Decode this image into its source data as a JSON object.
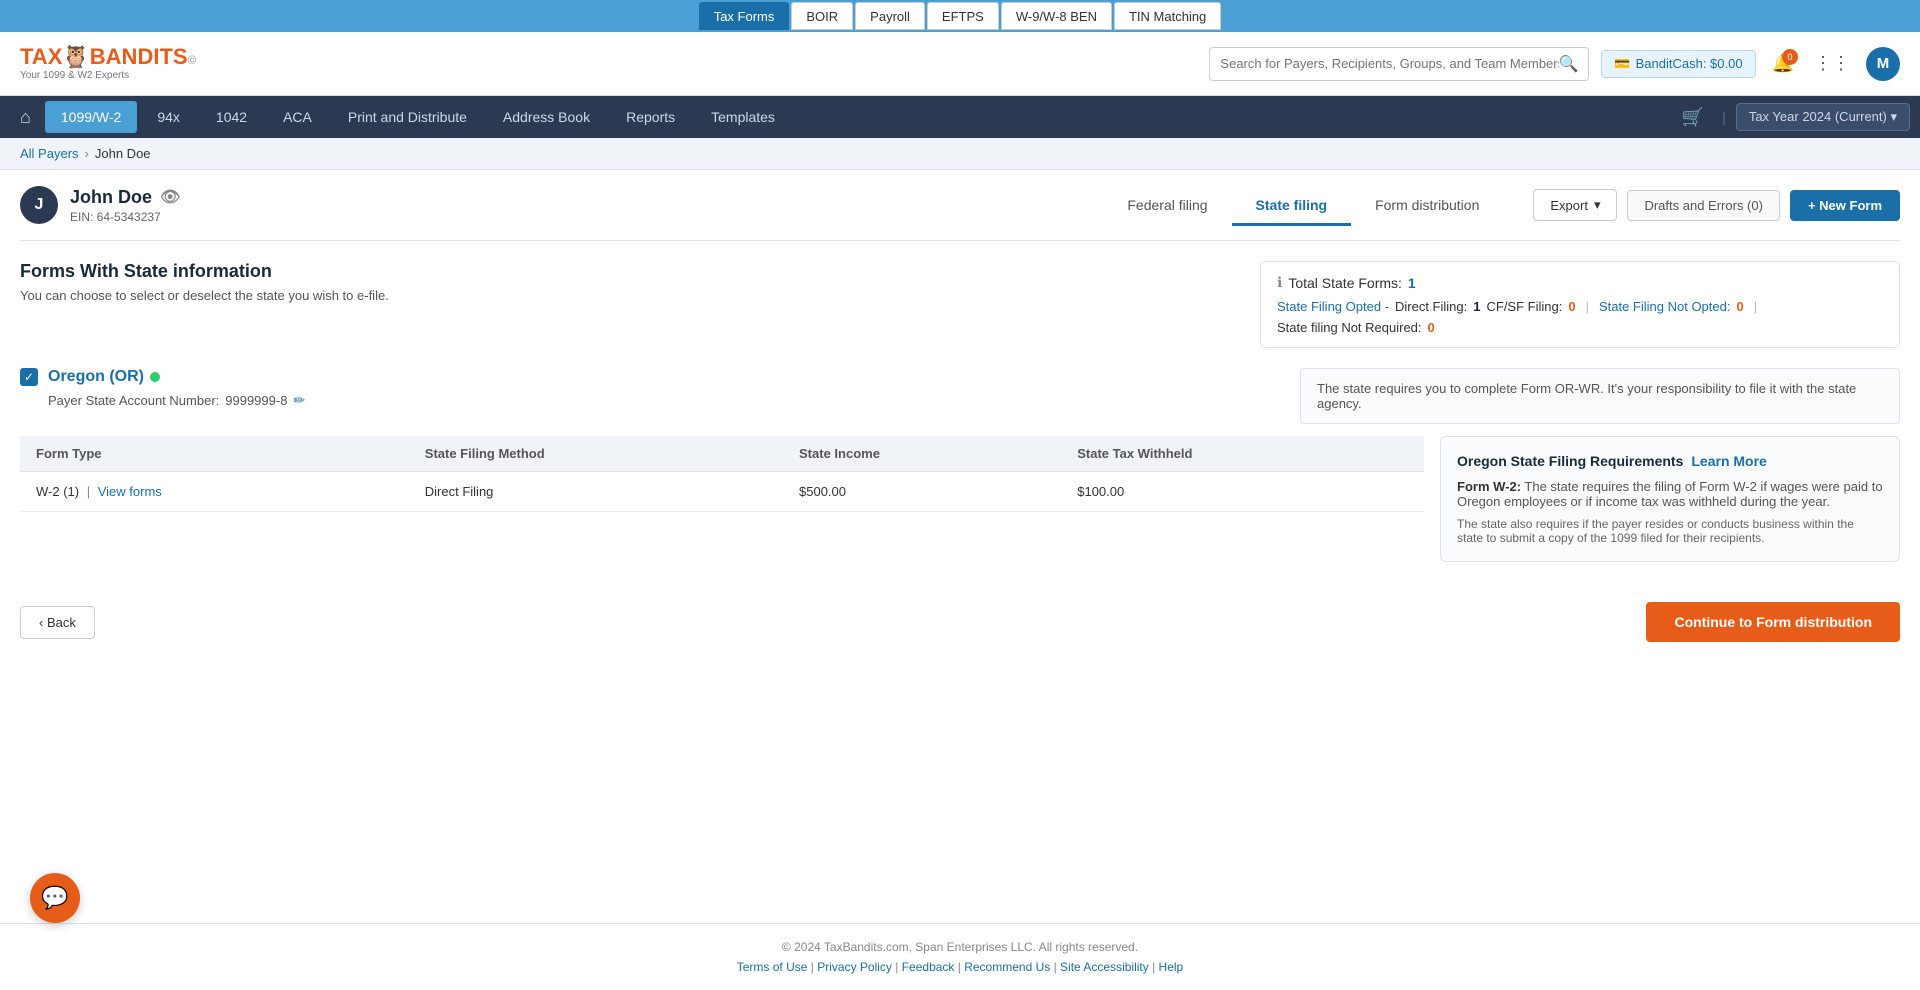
{
  "top_nav": {
    "items": [
      {
        "label": "Tax Forms",
        "active": true
      },
      {
        "label": "BOIR",
        "active": false
      },
      {
        "label": "Payroll",
        "active": false
      },
      {
        "label": "EFTPS",
        "active": false
      },
      {
        "label": "W-9/W-8 BEN",
        "active": false
      },
      {
        "label": "TIN Matching",
        "active": false
      }
    ]
  },
  "header": {
    "logo_text": "TAXBANDITS",
    "logo_sub": "Your 1099 & W2 Experts",
    "search_placeholder": "Search for Payers, Recipients, Groups, and Team Members",
    "bandit_cash_label": "BanditCash: $0.00",
    "notification_count": "0",
    "avatar_label": "M"
  },
  "main_nav": {
    "home_icon": "⌂",
    "items": [
      {
        "label": "1099/W-2",
        "active": true
      },
      {
        "label": "94x",
        "active": false
      },
      {
        "label": "1042",
        "active": false
      },
      {
        "label": "ACA",
        "active": false
      },
      {
        "label": "Print and Distribute",
        "active": false
      },
      {
        "label": "Address Book",
        "active": false
      },
      {
        "label": "Reports",
        "active": false
      },
      {
        "label": "Templates",
        "active": false
      }
    ],
    "cart_icon": "🛒",
    "divider": "|",
    "tax_year_label": "Tax Year 2024 (Current) ▾"
  },
  "breadcrumb": {
    "all_payers": "All Payers",
    "current": "John Doe",
    "sep": "›"
  },
  "payer": {
    "avatar": "J",
    "name": "John Doe",
    "ein_label": "EIN: 64-5343237",
    "eye_icon": "👁"
  },
  "payer_actions": {
    "export_label": "Export",
    "dropdown_arrow": "▾",
    "drafts_label": "Drafts and Errors (0)",
    "new_form_label": "+ New Form"
  },
  "tabs": [
    {
      "label": "Federal filing",
      "active": false
    },
    {
      "label": "State filing",
      "active": true
    },
    {
      "label": "Form distribution",
      "active": false
    }
  ],
  "section": {
    "title": "Forms With State information",
    "subtitle": "You can choose to select or deselect the state you wish to e-file."
  },
  "state_summary": {
    "total_label": "Total State Forms:",
    "total_count": "1",
    "opted_label": "State Filing Opted -",
    "direct_label": "Direct Filing:",
    "direct_count": "1",
    "cf_sf_label": "CF/SF Filing:",
    "cf_sf_count": "0",
    "not_opted_label": "State Filing Not Opted:",
    "not_opted_count": "0",
    "not_required_label": "State filing Not Required:",
    "not_required_count": "0"
  },
  "oregon": {
    "name": "Oregon (OR)",
    "account_label": "Payer State Account Number:",
    "account_number": "9999999-8",
    "note": "The state requires you to complete Form OR-WR. It's your responsibility to file it with the state agency."
  },
  "table": {
    "headers": [
      "Form Type",
      "State Filing Method",
      "State Income",
      "State Tax Withheld"
    ],
    "rows": [
      {
        "form_type": "W-2 (1)",
        "view_forms_label": "View forms",
        "filing_method": "Direct Filing",
        "state_income": "$500.00",
        "state_tax": "$100.00"
      }
    ]
  },
  "requirements": {
    "title": "Oregon State Filing Requirements",
    "learn_more": "Learn More",
    "form_label": "Form W-2:",
    "description": "The state requires the filing of Form W-2 if wages were paid to Oregon employees or if income tax was withheld during the year.",
    "note": "The state also requires if the payer resides or conducts business within the state to submit a copy of the 1099 filed for their recipients."
  },
  "bottom": {
    "back_label": "‹ Back",
    "continue_label": "Continue to Form distribution"
  },
  "footer": {
    "copyright": "© 2024 TaxBandits.com, Span Enterprises LLC. All rights reserved.",
    "links": [
      {
        "label": "Terms of Use"
      },
      {
        "label": "Privacy Policy"
      },
      {
        "label": "Feedback"
      },
      {
        "label": "Recommend Us"
      },
      {
        "label": "Site Accessibility"
      },
      {
        "label": "Help"
      }
    ]
  },
  "chat": {
    "icon": "💬"
  }
}
